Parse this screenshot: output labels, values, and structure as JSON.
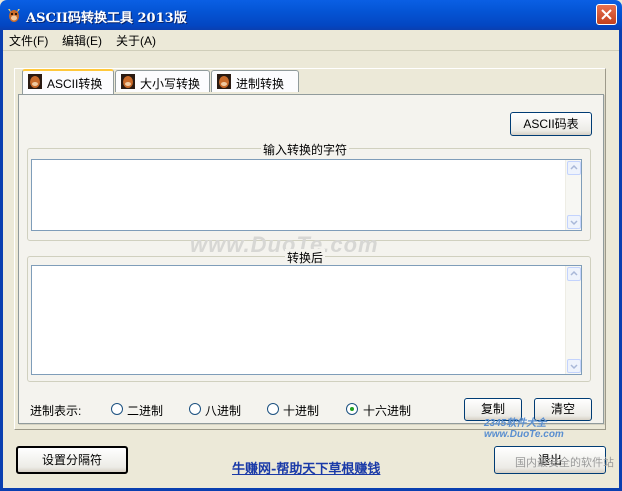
{
  "window": {
    "title": "ASCII码转换工具 2013版"
  },
  "menu": [
    "文件(F)",
    "编辑(E)",
    "关于(A)"
  ],
  "tabs": [
    "ASCII转换",
    "大小写转换",
    "进制转换"
  ],
  "ascii_table_button": "ASCII码表",
  "input_group": {
    "label": "输入转换的字符",
    "value": ""
  },
  "output_group": {
    "label": "转换后",
    "value": ""
  },
  "radix": {
    "label": "进制表示:",
    "options": [
      "二进制",
      "八进制",
      "十进制",
      "十六进制"
    ],
    "selected": "十六进制"
  },
  "copy_button": "复制",
  "clear_button": "清空",
  "separator_button": "设置分隔符",
  "footer_link": "牛赚网-帮助天下草根赚钱",
  "exit_button": "退出",
  "watermark": "www.DuoTe.com",
  "corner_watermark": {
    "top": "2345软件大全 www.DuoTe.com",
    "bottom": "国内最安全的软件站"
  },
  "colors": {
    "titlebar": "#0454d4",
    "link": "#1a3aa8",
    "face": "#ece9d8"
  }
}
